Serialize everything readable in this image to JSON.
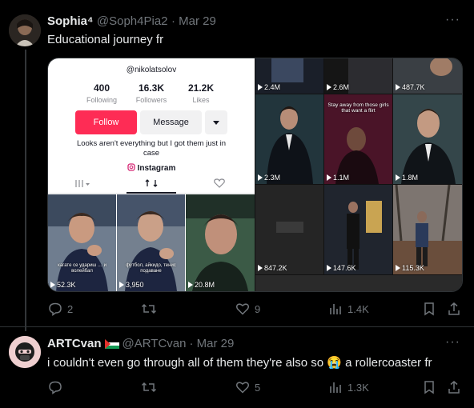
{
  "tweet1": {
    "name": "Sophia⁴",
    "handle": "@Soph4Pia2",
    "date": "· Mar 29",
    "more": "···",
    "text": "Educational journey fr",
    "replies": "2",
    "likes": "9",
    "views": "1.4K"
  },
  "profile": {
    "handle": "@nikolatsolov",
    "following_count": "400",
    "following_label": "Following",
    "followers_count": "16.3K",
    "followers_label": "Followers",
    "likes_count": "21.2K",
    "likes_label": "Likes",
    "follow_button": "Follow",
    "message_button": "Message",
    "bio": "Looks aren't everything but I got them just in case",
    "instagram": "Instagram"
  },
  "left_videos": [
    {
      "views": "52.3K",
      "caption": "кагате се удариш … и волейбал"
    },
    {
      "views": "3,950",
      "caption": "футбол, айкидо, тенис подаване"
    },
    {
      "views": "20.8M",
      "caption": ""
    }
  ],
  "grid": [
    {
      "views": "2.4M",
      "caption": ""
    },
    {
      "views": "2.6M",
      "caption": ""
    },
    {
      "views": "487.7K",
      "caption": ""
    },
    {
      "views": "2.3M",
      "caption": ""
    },
    {
      "views": "1.1M",
      "caption": "Stay away from those girls that want a flirt"
    },
    {
      "views": "1.8M",
      "caption": ""
    },
    {
      "views": "847.2K",
      "caption": ""
    },
    {
      "views": "147.6K",
      "caption": ""
    },
    {
      "views": "115.3K",
      "caption": ""
    }
  ],
  "tweet2": {
    "name": "ARTCvan",
    "handle": "@ARTCvan",
    "date": "· Mar 29",
    "more": "···",
    "text": "i couldn't even go through all of them they're also so",
    "emoji": "😭",
    "text_end": "a rollercoaster fr",
    "likes": "5",
    "views": "1.3K"
  },
  "colors": {
    "background": "#000000",
    "text": "#e7e9ea",
    "secondary": "#71767b",
    "follow_red": "#fe2c55"
  }
}
